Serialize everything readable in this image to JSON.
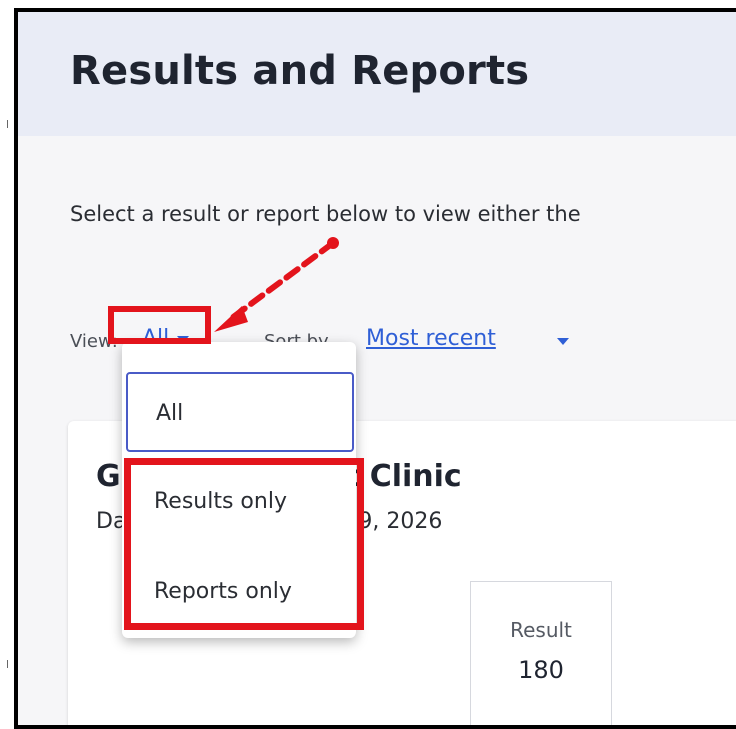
{
  "header": {
    "title": "Results and Reports"
  },
  "intro_text": "Select a result or report below to view either the",
  "controls": {
    "view_label": "View:",
    "view_value": "All",
    "sort_label": "Sort by",
    "sort_value": "Most recent"
  },
  "view_menu": {
    "options": [
      "All",
      "Results only",
      "Reports only"
    ],
    "selected": "All"
  },
  "card": {
    "title_left": "Gl",
    "title_right": "t Clinic",
    "date_left": "Da",
    "date_right": "9, 2026",
    "tile": {
      "label": "Result",
      "value": "180"
    }
  },
  "annotations": {
    "highlight_color": "#e3141c"
  }
}
